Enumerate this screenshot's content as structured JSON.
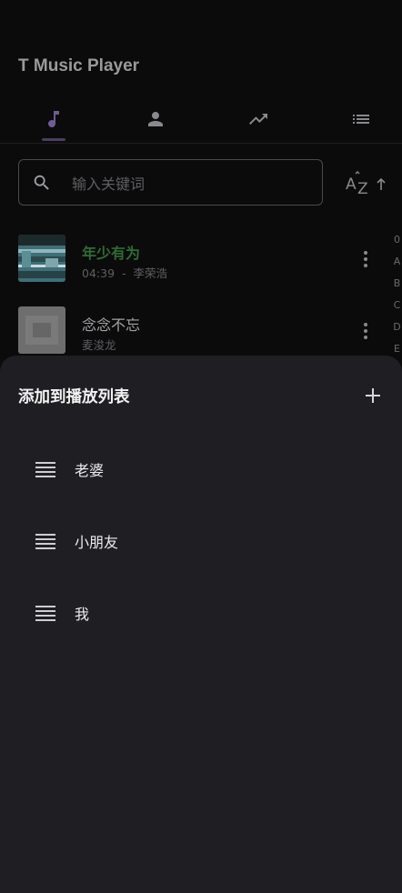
{
  "app": {
    "title": "T Music Player"
  },
  "tabs": [
    {
      "name": "songs",
      "icon": "music-note-icon",
      "active": true
    },
    {
      "name": "artists",
      "icon": "person-icon",
      "active": false
    },
    {
      "name": "trending",
      "icon": "trending-up-icon",
      "active": false
    },
    {
      "name": "playlists",
      "icon": "list-icon",
      "active": false
    }
  ],
  "search": {
    "placeholder": "输入关键词",
    "value": ""
  },
  "sort": {
    "icon": "sort-az-ascending-icon"
  },
  "songs": [
    {
      "title": "年少有为",
      "duration": "04:39",
      "separator": "-",
      "artist": "李荣浩",
      "playing": true
    },
    {
      "title": "念念不忘",
      "artist": "麦浚龙",
      "playing": false
    }
  ],
  "alphabet_index": [
    "0",
    "A",
    "B",
    "C",
    "D",
    "E"
  ],
  "sheet": {
    "title": "添加到播放列表",
    "add_icon": "plus-icon",
    "playlists": [
      {
        "label": "老婆"
      },
      {
        "label": "小朋友"
      },
      {
        "label": "我"
      }
    ]
  },
  "colors": {
    "background": "#0b0b0c",
    "sheet": "#1f1e23",
    "accent_playing": "#2f6b34",
    "tab_active": "#6e5c94",
    "tab_inactive": "#8a8a8e"
  }
}
